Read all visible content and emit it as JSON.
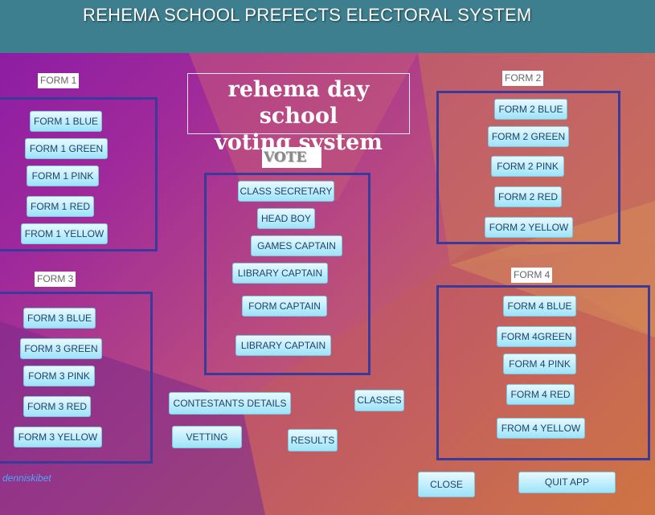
{
  "app_title": "REHEMA SCHOOL PREFECTS ELECTORAL SYSTEM",
  "subtitle_lines": [
    "rehema day school",
    "voting system"
  ],
  "vote_label": "VOTE",
  "form1": {
    "label": "FORM 1",
    "buttons": [
      "FORM 1 BLUE",
      "FORM 1 GREEN",
      "FORM 1 PINK",
      "FORM 1 RED",
      "FROM 1 YELLOW"
    ]
  },
  "form2": {
    "label": "FORM 2",
    "buttons": [
      "FORM 2 BLUE",
      "FORM 2 GREEN",
      "FORM 2 PINK",
      "FORM 2 RED",
      "FORM 2 YELLOW"
    ]
  },
  "form3": {
    "label": "FORM 3",
    "buttons": [
      "FORM 3 BLUE",
      "FORM 3 GREEN",
      "FORM 3 PINK",
      "FORM 3 RED",
      "FORM 3 YELLOW"
    ]
  },
  "form4": {
    "label": "FORM 4",
    "buttons": [
      "FORM 4 BLUE",
      "FORM 4GREEN",
      "FORM 4 PINK",
      "FORM 4 RED",
      "FROM 4 YELLOW"
    ]
  },
  "vote_buttons": [
    "CLASS SECRETARY",
    "HEAD BOY",
    "GAMES CAPTAIN",
    "LIBRARY CAPTAIN",
    "FORM CAPTAIN",
    "LIBRARY CAPTAIN"
  ],
  "actions": {
    "contestants": "CONTESTANTS DETAILS",
    "classes": "CLASSES",
    "vetting": "VETTING",
    "results": "RESULTS",
    "close": "CLOSE",
    "quit": "QUIT APP"
  },
  "credit": "denniskibet",
  "colors": {
    "title_bar": "#3d7f8f",
    "group_border": "#3a3a9a",
    "button_fill": "#bdeefc",
    "credit_text": "#4aa8ff"
  }
}
